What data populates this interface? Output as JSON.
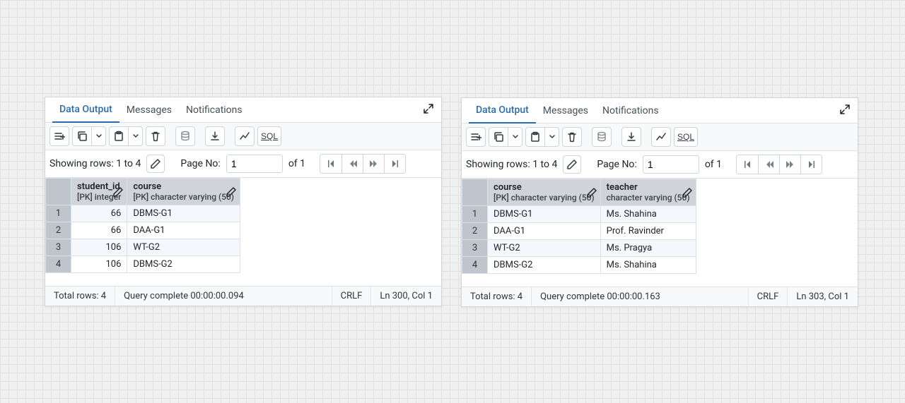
{
  "tabs": {
    "data_output": "Data Output",
    "messages": "Messages",
    "notifications": "Notifications"
  },
  "toolbar": {
    "sql_label": "SQL"
  },
  "pager": {
    "rows_label": "Showing rows: 1 to 4",
    "page_label": "Page No:",
    "page_value": "1",
    "of_label": "of 1"
  },
  "panels": [
    {
      "columns": [
        {
          "name": "student_id",
          "type": "[PK] integer",
          "align": "right"
        },
        {
          "name": "course",
          "type": "[PK] character varying (50)",
          "align": "left"
        }
      ],
      "rows": [
        {
          "n": "1",
          "c": [
            "66",
            "DBMS-G1"
          ]
        },
        {
          "n": "2",
          "c": [
            "66",
            "DAA-G1"
          ]
        },
        {
          "n": "3",
          "c": [
            "106",
            "WT-G2"
          ]
        },
        {
          "n": "4",
          "c": [
            "106",
            "DBMS-G2"
          ]
        }
      ],
      "status": {
        "total": "Total rows: 4",
        "query": "Query complete 00:00:00.094",
        "eol": "CRLF",
        "pos": "Ln 300, Col 1"
      }
    },
    {
      "columns": [
        {
          "name": "course",
          "type": "[PK] character varying (50)",
          "align": "left"
        },
        {
          "name": "teacher",
          "type": "character varying (50)",
          "align": "left"
        }
      ],
      "rows": [
        {
          "n": "1",
          "c": [
            "DBMS-G1",
            "Ms. Shahina"
          ]
        },
        {
          "n": "2",
          "c": [
            "DAA-G1",
            "Prof. Ravinder"
          ]
        },
        {
          "n": "3",
          "c": [
            "WT-G2",
            "Ms. Pragya"
          ]
        },
        {
          "n": "4",
          "c": [
            "DBMS-G2",
            "Ms. Shahina"
          ]
        }
      ],
      "status": {
        "total": "Total rows: 4",
        "query": "Query complete 00:00:00.163",
        "eol": "CRLF",
        "pos": "Ln 303, Col 1"
      }
    }
  ]
}
